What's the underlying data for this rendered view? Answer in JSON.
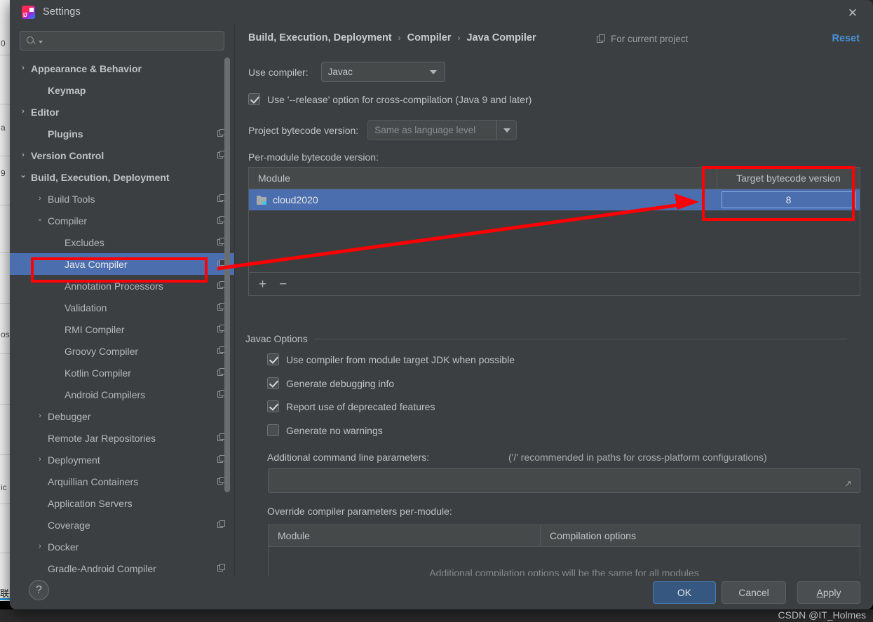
{
  "window": {
    "title": "Settings",
    "logo_icon": "intellij-idea-logo",
    "close_icon": "close-icon"
  },
  "search": {
    "placeholder": "",
    "value": "",
    "icon": "search-icon",
    "caret_icon": "chevron-down-icon"
  },
  "sidebar": {
    "items": [
      {
        "label": "Appearance & Behavior",
        "chevron": "›",
        "indent": 0,
        "bold": true,
        "copy": false,
        "selected": false
      },
      {
        "label": "Keymap",
        "chevron": "",
        "indent": 1,
        "bold": true,
        "copy": false,
        "selected": false
      },
      {
        "label": "Editor",
        "chevron": "›",
        "indent": 0,
        "bold": true,
        "copy": false,
        "selected": false
      },
      {
        "label": "Plugins",
        "chevron": "",
        "indent": 1,
        "bold": true,
        "copy": true,
        "selected": false
      },
      {
        "label": "Version Control",
        "chevron": "›",
        "indent": 0,
        "bold": true,
        "copy": true,
        "selected": false
      },
      {
        "label": "Build, Execution, Deployment",
        "chevron": "⌄",
        "indent": 0,
        "bold": true,
        "copy": false,
        "selected": false
      },
      {
        "label": "Build Tools",
        "chevron": "›",
        "indent": 1,
        "bold": false,
        "copy": true,
        "selected": false
      },
      {
        "label": "Compiler",
        "chevron": "⌄",
        "indent": 1,
        "bold": false,
        "copy": true,
        "selected": false
      },
      {
        "label": "Excludes",
        "chevron": "",
        "indent": 2,
        "bold": false,
        "copy": true,
        "selected": false
      },
      {
        "label": "Java Compiler",
        "chevron": "",
        "indent": 2,
        "bold": false,
        "copy": true,
        "selected": true
      },
      {
        "label": "Annotation Processors",
        "chevron": "",
        "indent": 2,
        "bold": false,
        "copy": true,
        "selected": false
      },
      {
        "label": "Validation",
        "chevron": "",
        "indent": 2,
        "bold": false,
        "copy": true,
        "selected": false
      },
      {
        "label": "RMI Compiler",
        "chevron": "",
        "indent": 2,
        "bold": false,
        "copy": true,
        "selected": false
      },
      {
        "label": "Groovy Compiler",
        "chevron": "",
        "indent": 2,
        "bold": false,
        "copy": true,
        "selected": false
      },
      {
        "label": "Kotlin Compiler",
        "chevron": "",
        "indent": 2,
        "bold": false,
        "copy": true,
        "selected": false
      },
      {
        "label": "Android Compilers",
        "chevron": "",
        "indent": 2,
        "bold": false,
        "copy": true,
        "selected": false
      },
      {
        "label": "Debugger",
        "chevron": "›",
        "indent": 1,
        "bold": false,
        "copy": false,
        "selected": false
      },
      {
        "label": "Remote Jar Repositories",
        "chevron": "",
        "indent": 1,
        "bold": false,
        "copy": true,
        "selected": false
      },
      {
        "label": "Deployment",
        "chevron": "›",
        "indent": 1,
        "bold": false,
        "copy": true,
        "selected": false
      },
      {
        "label": "Arquillian Containers",
        "chevron": "",
        "indent": 1,
        "bold": false,
        "copy": true,
        "selected": false
      },
      {
        "label": "Application Servers",
        "chevron": "",
        "indent": 1,
        "bold": false,
        "copy": false,
        "selected": false
      },
      {
        "label": "Coverage",
        "chevron": "",
        "indent": 1,
        "bold": false,
        "copy": true,
        "selected": false
      },
      {
        "label": "Docker",
        "chevron": "›",
        "indent": 1,
        "bold": false,
        "copy": false,
        "selected": false
      },
      {
        "label": "Gradle-Android Compiler",
        "chevron": "",
        "indent": 1,
        "bold": false,
        "copy": true,
        "selected": false
      }
    ]
  },
  "header": {
    "breadcrumb": [
      "Build, Execution, Deployment",
      "Compiler",
      "Java Compiler"
    ],
    "separator": "›",
    "scope_label": "For current project",
    "scope_icon": "copy-icon",
    "reset_label": "Reset"
  },
  "form": {
    "use_compiler_label": "Use compiler:",
    "use_compiler_value": "Javac",
    "release_option_label": "Use '--release' option for cross-compilation (Java 9 and later)",
    "release_option_checked": true,
    "project_bytecode_label": "Project bytecode version:",
    "project_bytecode_value": "Same as language level",
    "per_module_label": "Per-module bytecode version:"
  },
  "module_table": {
    "headers": [
      "Module",
      "Target bytecode version"
    ],
    "rows": [
      {
        "module": "cloud2020",
        "target": "8",
        "icon": "module-folder-icon",
        "selected": true
      }
    ],
    "toolbar": {
      "add": "+",
      "remove": "−"
    }
  },
  "javac_options": {
    "group_title": "Javac Options",
    "checkboxes": [
      {
        "label": "Use compiler from module target JDK when possible",
        "checked": true
      },
      {
        "label": "Generate debugging info",
        "checked": true
      },
      {
        "label": "Report use of deprecated features",
        "checked": true
      },
      {
        "label": "Generate no warnings",
        "checked": false
      }
    ],
    "additional_params_label": "Additional command line parameters:",
    "additional_params_hint": "('/' recommended in paths for cross-platform configurations)",
    "additional_params_value": "",
    "override_label": "Override compiler parameters per-module:"
  },
  "override_table": {
    "headers": [
      "Module",
      "Compilation options"
    ],
    "empty_text": "Additional compilation options will be the same for all modules"
  },
  "footer": {
    "help_label": "?",
    "ok_label": "OK",
    "cancel_label": "Cancel",
    "apply_label": "Apply",
    "apply_mnemonic": "A",
    "apply_rest": "pply"
  },
  "annotations": {
    "watermark": "CSDN @IT_Holmes",
    "highlight_color": "#ff0000",
    "boxes": [
      {
        "name": "java-compiler-highlight"
      },
      {
        "name": "target-bytecode-highlight"
      }
    ],
    "arrow": {
      "name": "pointer-arrow",
      "from": "java-compiler-highlight",
      "to": "target-bytecode-cell"
    }
  },
  "background": {
    "left_labels": [
      "0",
      "a",
      "9",
      "os",
      "ic"
    ],
    "cjk": "联想"
  }
}
